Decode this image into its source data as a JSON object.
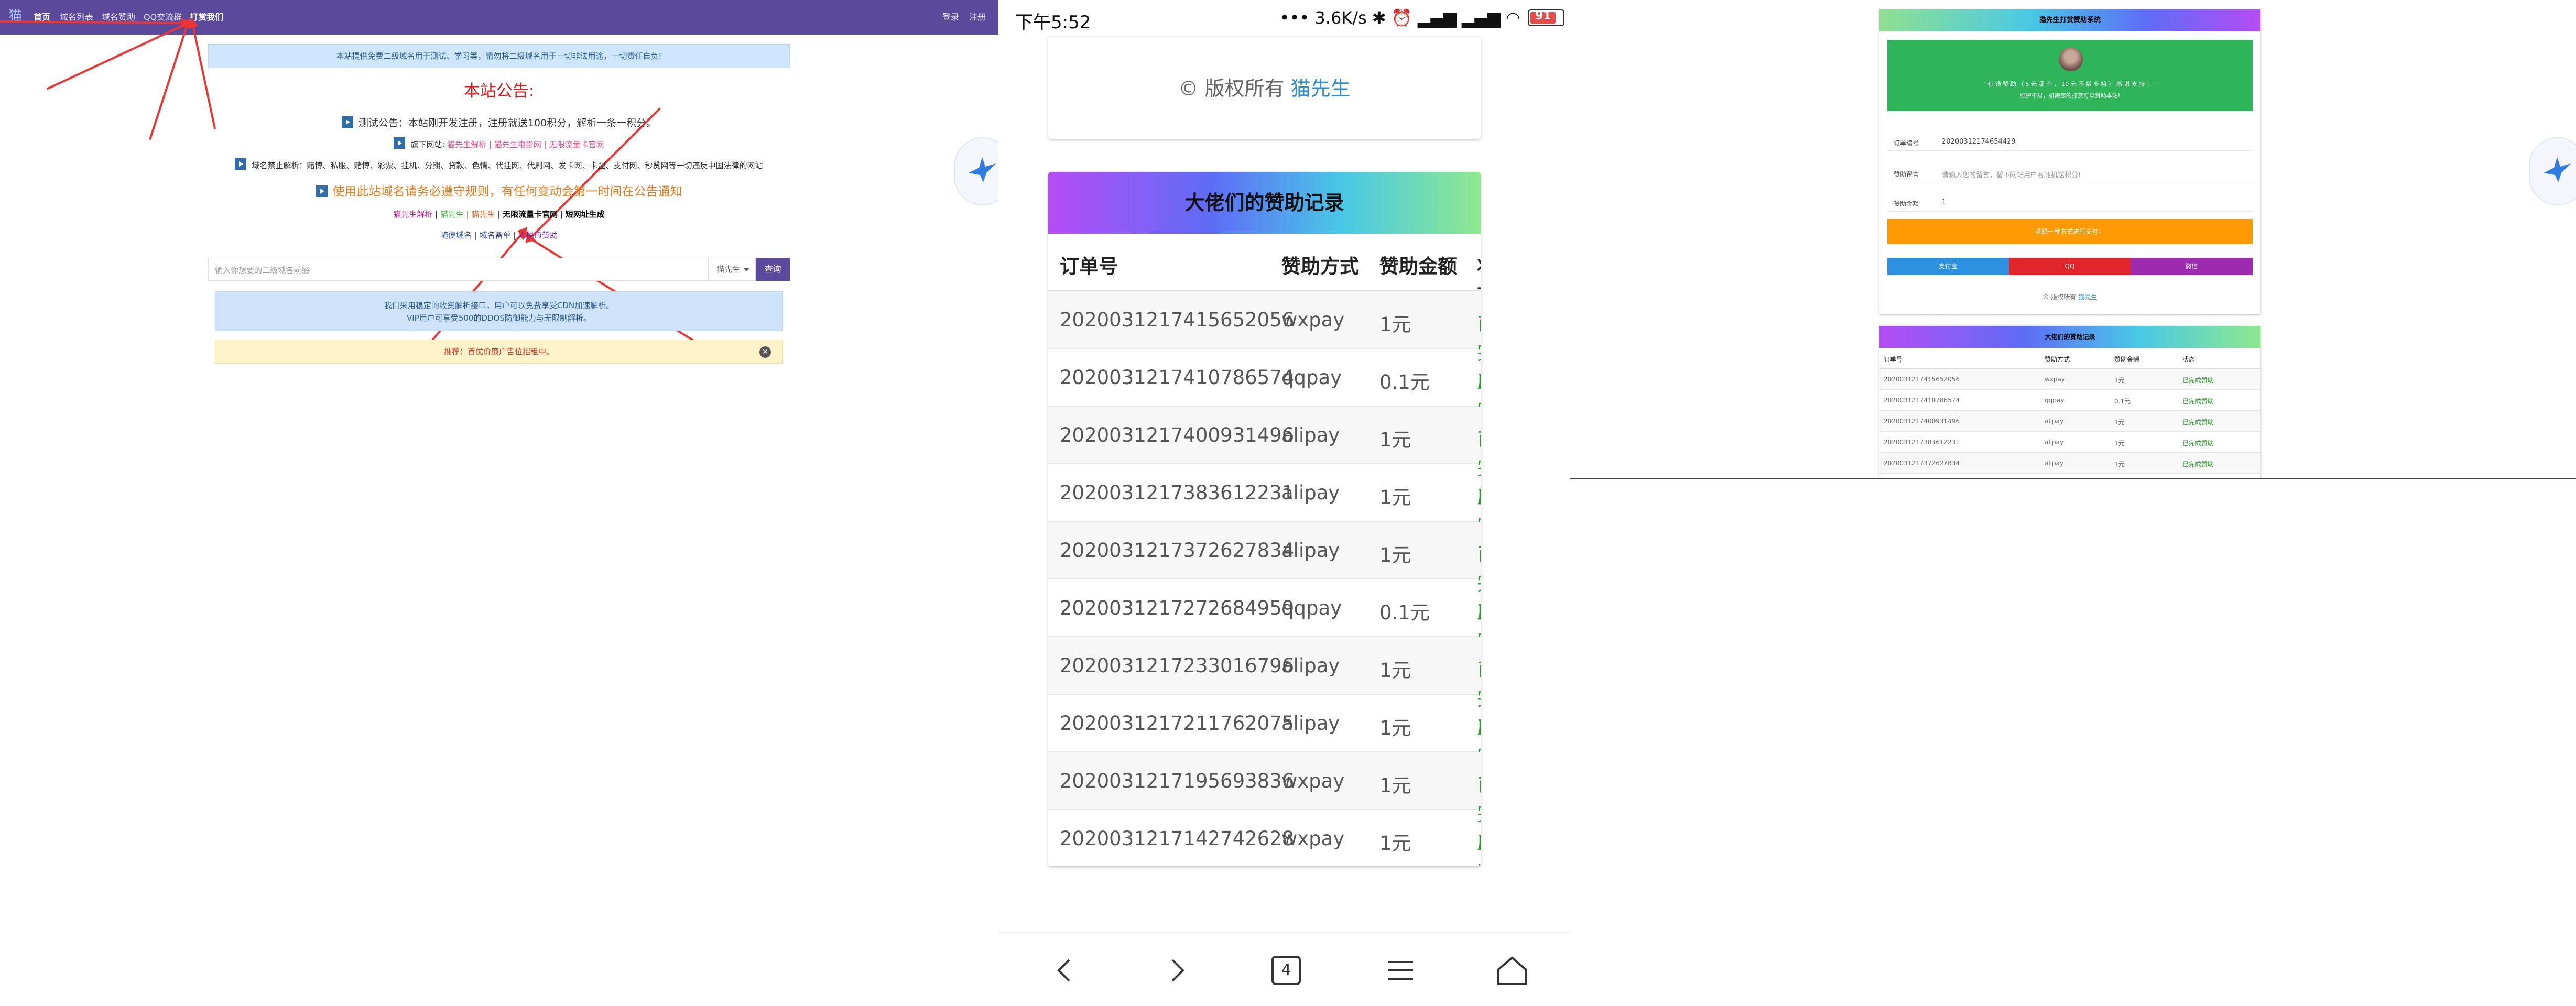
{
  "left": {
    "nav": {
      "logo": "猫",
      "items": [
        "首页",
        "域名列表",
        "域名赞助",
        "QQ交流群",
        "打赏我们"
      ],
      "right": [
        "登录",
        "注册"
      ]
    },
    "notice": "本站提供免费二级域名用于测试、学习等，请勿将二级域名用于一切非法用途，一切责任自负!",
    "announce_title": "本站公告:",
    "line1": "测试公告：本站刚开发注册，注册就送100积分，解析一条一积分。",
    "line2_label": "旗下网站:",
    "line2_links": "猫先生解析 | 猫先生电影网 | 无限流量卡官网",
    "line3": "域名禁止解析：赌博、私服、赌博、彩票、挂机、分期、贷款、色情、代挂网、代刷网、发卡网、卡盟、支付网、秒赞网等一切违反中国法律的网站",
    "line4": "使用此站域名请务必遵守规则，有任何变动会第一时间在公告通知",
    "line5": {
      "a": "猫先生解析",
      "b": "猫先生",
      "c": "猫先生",
      "d": "无限流量卡官网",
      "e": "短网址生成"
    },
    "line6": {
      "a": "随便域名",
      "b": "域名备单",
      "c": "人民币赞助"
    },
    "search": {
      "placeholder": "输入你想要的二级域名前缀",
      "select": "猫先生",
      "button": "查询"
    },
    "info1": "我们采用稳定的收费解析接口，用户可以免费享受CDN加速解析。",
    "info2": "VIP用户可享受500的DDOS防御能力与无限制解析。",
    "warn": "推荐：首优价廉广告位招租中。",
    "warn_close": "✕"
  },
  "phone": {
    "time": "下午5:52",
    "status": "3.6K/s",
    "battery": "91",
    "copyright_prefix": "© 版权所有",
    "copyright_brand": "猫先生",
    "table_title": "大佬们的赞助记录",
    "columns": [
      "订单号",
      "赞助方式",
      "赞助金额",
      "状态"
    ],
    "rows": [
      [
        "2020031217415652056",
        "wxpay",
        "1元",
        "已完成"
      ],
      [
        "2020031217410786574",
        "qqpay",
        "0.1元",
        "已完成"
      ],
      [
        "2020031217400931496",
        "alipay",
        "1元",
        "已完成"
      ],
      [
        "2020031217383612231",
        "alipay",
        "1元",
        "已完成"
      ],
      [
        "2020031217372627834",
        "alipay",
        "1元",
        "已完成"
      ],
      [
        "2020031217272684959",
        "qqpay",
        "0.1元",
        "已完成"
      ],
      [
        "2020031217233016796",
        "alipay",
        "1元",
        "已完成"
      ],
      [
        "2020031217211762075",
        "alipay",
        "1元",
        "已完成"
      ],
      [
        "2020031217195693836",
        "wxpay",
        "1元",
        "已完成"
      ],
      [
        "2020031217142742628",
        "wxpay",
        "1元",
        "已完成"
      ]
    ],
    "tabs_count": "4"
  },
  "right": {
    "title": "猫先生打赏赞助系统",
    "green1": "\" 有 钱 赞 助 （ 5 元 哪 个 ， 10 元 不 嫌 多 嘛 ） 感 谢 支 持 ！ \"",
    "green2": "维护不易，如需您的打赏可以赞助本站!",
    "f1_label": "订单编号",
    "f1_value": "20200312174654429",
    "f2_label": "赞助留言",
    "f2_value": "请输入您的留言，留下网站用户名随机送积分!",
    "f3_label": "赞助金额",
    "f3_value": "1",
    "orange": "选择一种方式进行支付。",
    "pay": [
      "支付宝",
      "QQ",
      "微信"
    ],
    "copy_prefix": "© 版权所有",
    "copy_brand": "猫先生",
    "table_title": "大佬们的赞助记录",
    "columns": [
      "订单号",
      "赞助方式",
      "赞助金额",
      "状态"
    ],
    "rows": [
      [
        "2020031217415652056",
        "wxpay",
        "1元",
        "已完成赞助"
      ],
      [
        "2020031217410786574",
        "qqpay",
        "0.1元",
        "已完成赞助"
      ],
      [
        "2020031217400931496",
        "alipay",
        "1元",
        "已完成赞助"
      ],
      [
        "2020031217383612231",
        "alipay",
        "1元",
        "已完成赞助"
      ],
      [
        "2020031217372627834",
        "alipay",
        "1元",
        "已完成赞助"
      ]
    ]
  },
  "colors": {
    "nav": "#5b4a9b",
    "announce": "#e01b1b",
    "orange": "#ff9a05",
    "green": "#2eb55a",
    "status_done": "#2a9a2a",
    "alipay": "#2d8fe0",
    "qq": "#e0262a",
    "wechat": "#9c2bb0"
  }
}
